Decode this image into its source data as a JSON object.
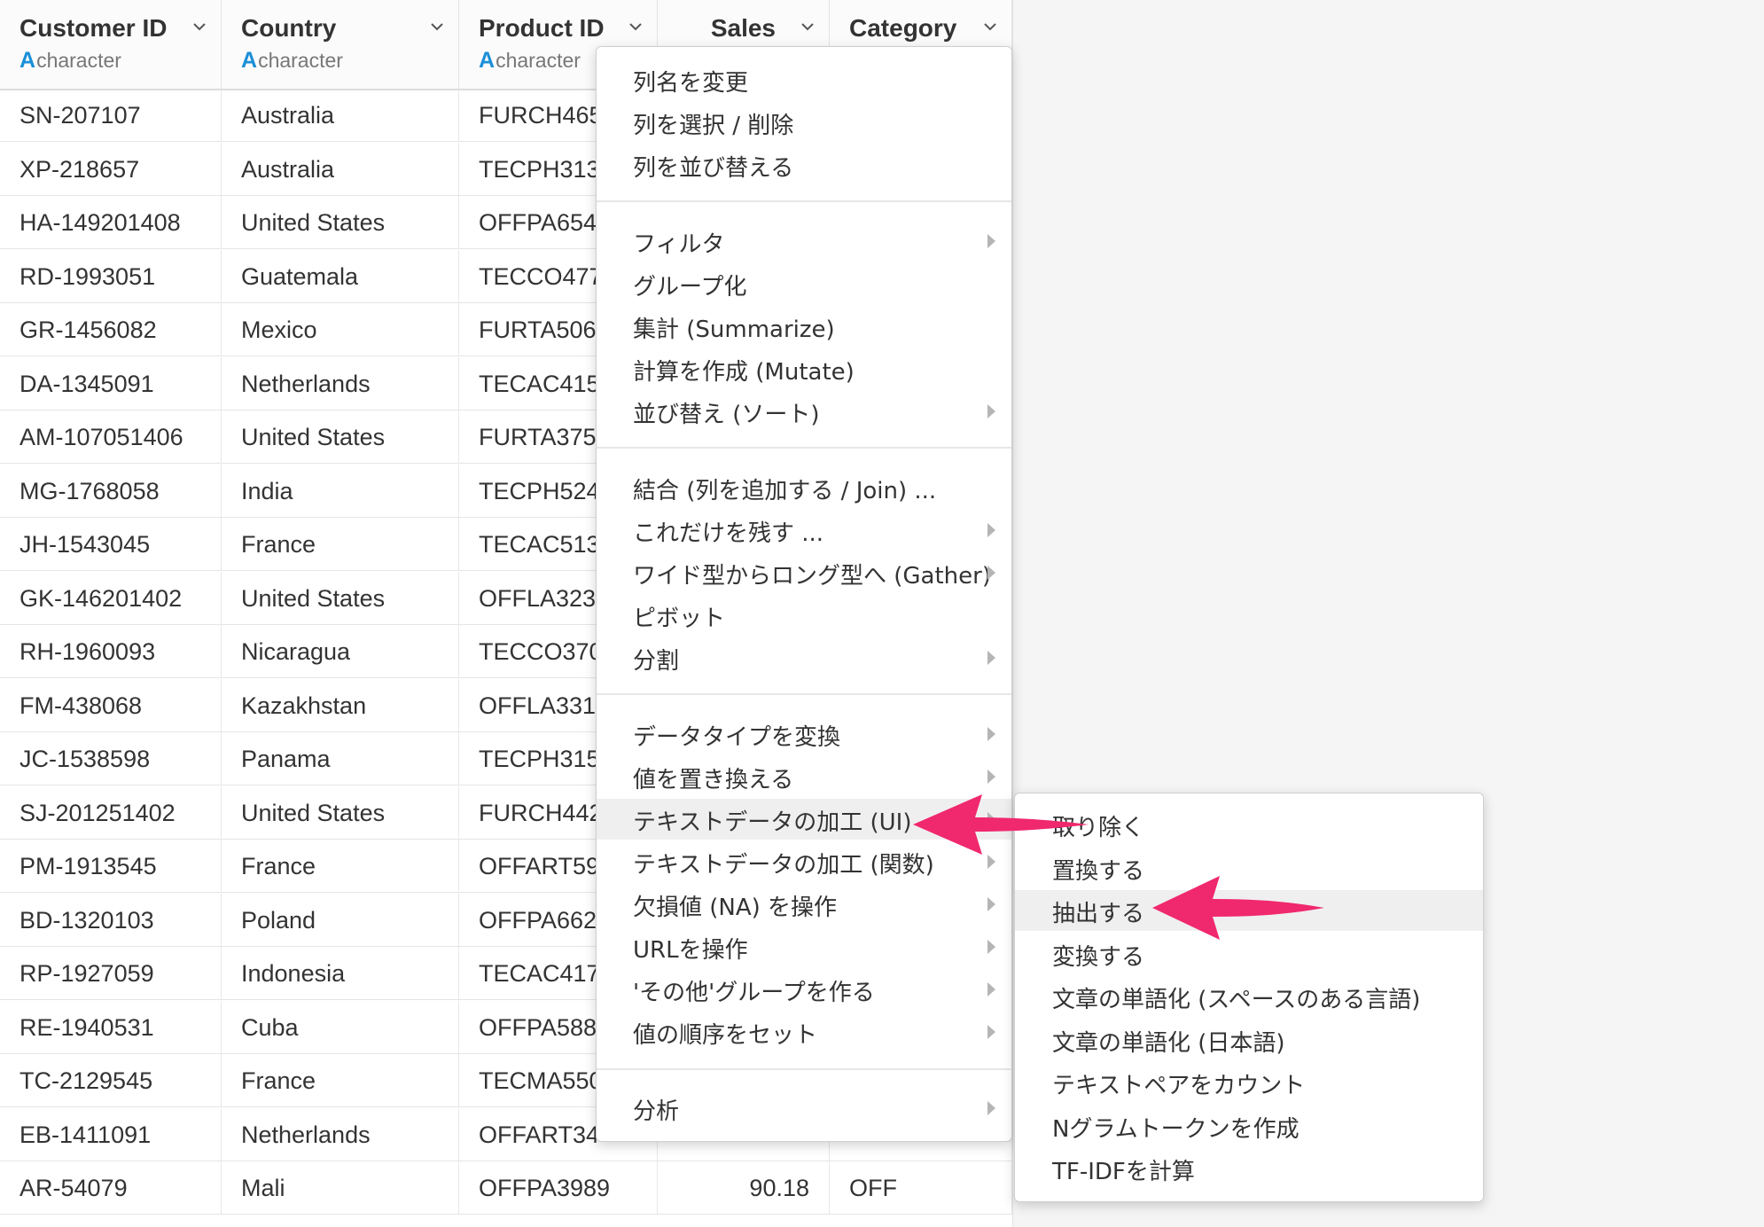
{
  "columns": [
    {
      "name": "Customer ID",
      "type_letter": "A",
      "type": "character"
    },
    {
      "name": "Country",
      "type_letter": "A",
      "type": "character"
    },
    {
      "name": "Product ID",
      "type_letter": "A",
      "type": "character"
    },
    {
      "name": "Sales",
      "type_letter": "",
      "type": ""
    },
    {
      "name": "Category",
      "type_letter": "",
      "type": ""
    }
  ],
  "rows": [
    [
      "SN-207107",
      "Australia",
      "FURCH465",
      "",
      ""
    ],
    [
      "XP-218657",
      "Australia",
      "TECPH313",
      "",
      ""
    ],
    [
      "HA-149201408",
      "United States",
      "OFFPA654",
      "",
      ""
    ],
    [
      "RD-1993051",
      "Guatemala",
      "TECCO477",
      "",
      ""
    ],
    [
      "GR-1456082",
      "Mexico",
      "FURTA506",
      "",
      ""
    ],
    [
      "DA-1345091",
      "Netherlands",
      "TECAC415",
      "",
      ""
    ],
    [
      "AM-107051406",
      "United States",
      "FURTA375",
      "",
      ""
    ],
    [
      "MG-1768058",
      "India",
      "TECPH524",
      "",
      ""
    ],
    [
      "JH-1543045",
      "France",
      "TECAC513",
      "",
      ""
    ],
    [
      "GK-146201402",
      "United States",
      "OFFLA323",
      "",
      ""
    ],
    [
      "RH-1960093",
      "Nicaragua",
      "TECCO370",
      "",
      ""
    ],
    [
      "FM-438068",
      "Kazakhstan",
      "OFFLA331",
      "",
      ""
    ],
    [
      "JC-1538598",
      "Panama",
      "TECPH315",
      "",
      ""
    ],
    [
      "SJ-201251402",
      "United States",
      "FURCH442",
      "",
      ""
    ],
    [
      "PM-1913545",
      "France",
      "OFFART59",
      "",
      ""
    ],
    [
      "BD-1320103",
      "Poland",
      "OFFPA662",
      "",
      ""
    ],
    [
      "RP-1927059",
      "Indonesia",
      "TECAC417",
      "",
      ""
    ],
    [
      "RE-1940531",
      "Cuba",
      "OFFPA588",
      "",
      ""
    ],
    [
      "TC-2129545",
      "France",
      "TECMA550",
      "",
      ""
    ],
    [
      "EB-1411091",
      "Netherlands",
      "OFFART34",
      "",
      ""
    ],
    [
      "AR-54079",
      "Mali",
      "OFFPA3989",
      "90.18",
      "OFF"
    ]
  ],
  "menu": [
    {
      "label": "列名を変更",
      "submenu": false
    },
    {
      "label": "列を選択 / 削除",
      "submenu": false
    },
    {
      "label": "列を並び替える",
      "submenu": false
    },
    {
      "label": "フィルタ",
      "submenu": true
    },
    {
      "label": "グループ化",
      "submenu": false
    },
    {
      "label": "集計 (Summarize)",
      "submenu": false
    },
    {
      "label": "計算を作成 (Mutate)",
      "submenu": false
    },
    {
      "label": "並び替え (ソート)",
      "submenu": true
    },
    {
      "label": "結合 (列を追加する / Join) ...",
      "submenu": false
    },
    {
      "label": "これだけを残す ...",
      "submenu": true
    },
    {
      "label": "ワイド型からロング型へ (Gather)",
      "submenu": true
    },
    {
      "label": "ピボット",
      "submenu": false
    },
    {
      "label": "分割",
      "submenu": true
    },
    {
      "label": "データタイプを変換",
      "submenu": true
    },
    {
      "label": "値を置き換える",
      "submenu": true
    },
    {
      "label": "テキストデータの加工 (UI)",
      "submenu": true,
      "active": true
    },
    {
      "label": "テキストデータの加工 (関数)",
      "submenu": true
    },
    {
      "label": "欠損値 (NA) を操作",
      "submenu": true
    },
    {
      "label": "URLを操作",
      "submenu": true
    },
    {
      "label": "'その他'グループを作る",
      "submenu": true
    },
    {
      "label": "値の順序をセット",
      "submenu": true
    },
    {
      "label": "分析",
      "submenu": true
    }
  ],
  "submenu": [
    {
      "label": "取り除く"
    },
    {
      "label": "置換する"
    },
    {
      "label": "抽出する",
      "active": true
    },
    {
      "label": "変換する"
    },
    {
      "label": "文章の単語化 (スペースのある言語)"
    },
    {
      "label": "文章の単語化 (日本語)"
    },
    {
      "label": "テキストペアをカウント"
    },
    {
      "label": "Nグラムトークンを作成"
    },
    {
      "label": "TF-IDFを計算"
    }
  ],
  "colors": {
    "accent_blue": "#1a8fd8",
    "arrow_pink": "#f0286e",
    "active_item_bg": "#efefef"
  }
}
